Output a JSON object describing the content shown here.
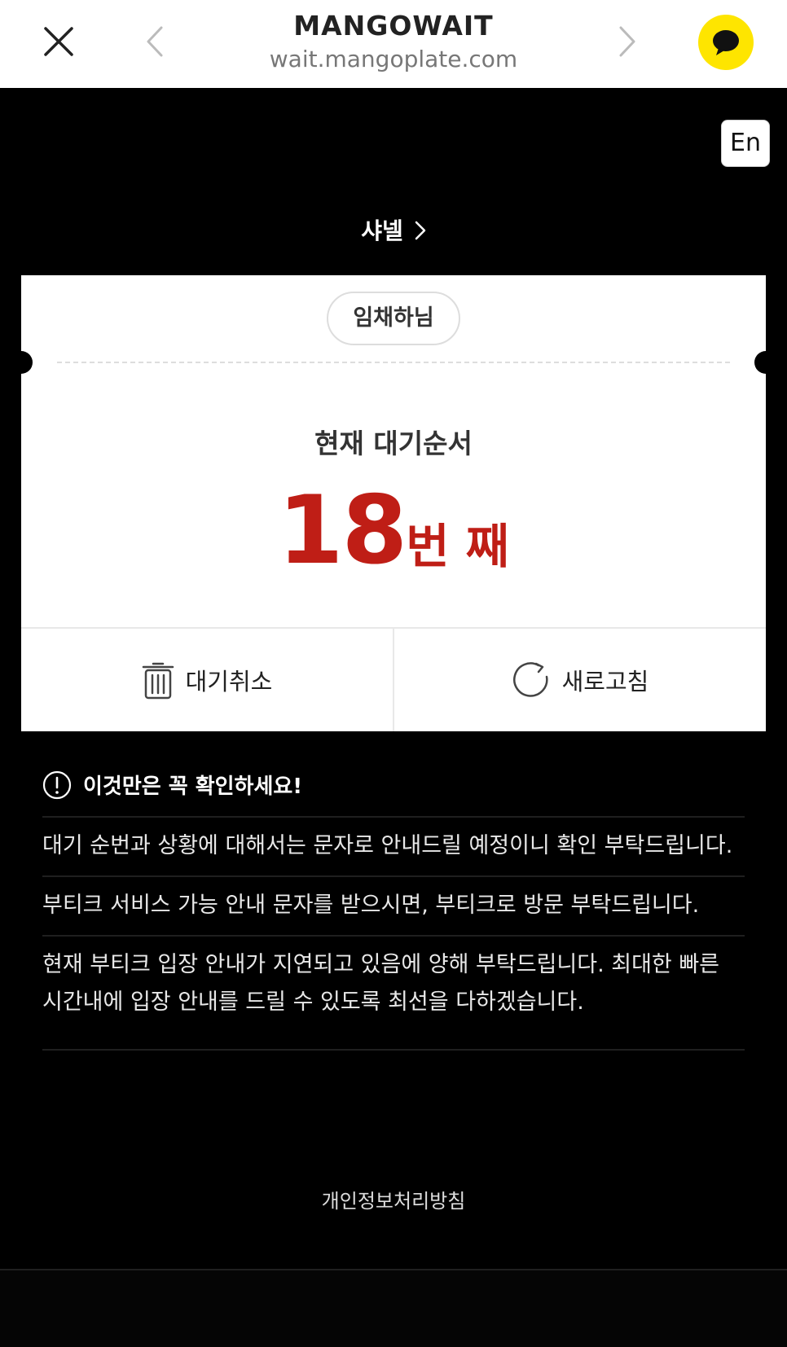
{
  "browser": {
    "title": "MANGOWAIT",
    "url": "wait.mangoplate.com",
    "chat_color": "#FEE500"
  },
  "language_toggle": "En",
  "store_name": "샤넬",
  "ticket": {
    "customer_name": "임채하님",
    "queue_label": "현재 대기순서",
    "queue_number": "18",
    "queue_unit": "번 째",
    "accent_color": "#BF1E16",
    "cancel_label": "대기취소",
    "refresh_label": "새로고침"
  },
  "notice": {
    "heading": "이것만은 꼭 확인하세요!",
    "items": [
      "대기 순번과 상황에 대해서는 문자로 안내드릴 예정이니 확인 부탁드립니다.",
      "부티크 서비스 가능 안내 문자를 받으시면, 부티크로 방문 부탁드립니다.",
      "현재 부티크 입장 안내가 지연되고 있음에 양해 부탁드립니다. 최대한 빠른 시간내에 입장 안내를 드릴 수 있도록 최선을 다하겠습니다."
    ]
  },
  "footer": {
    "privacy_link": "개인정보처리방침"
  }
}
